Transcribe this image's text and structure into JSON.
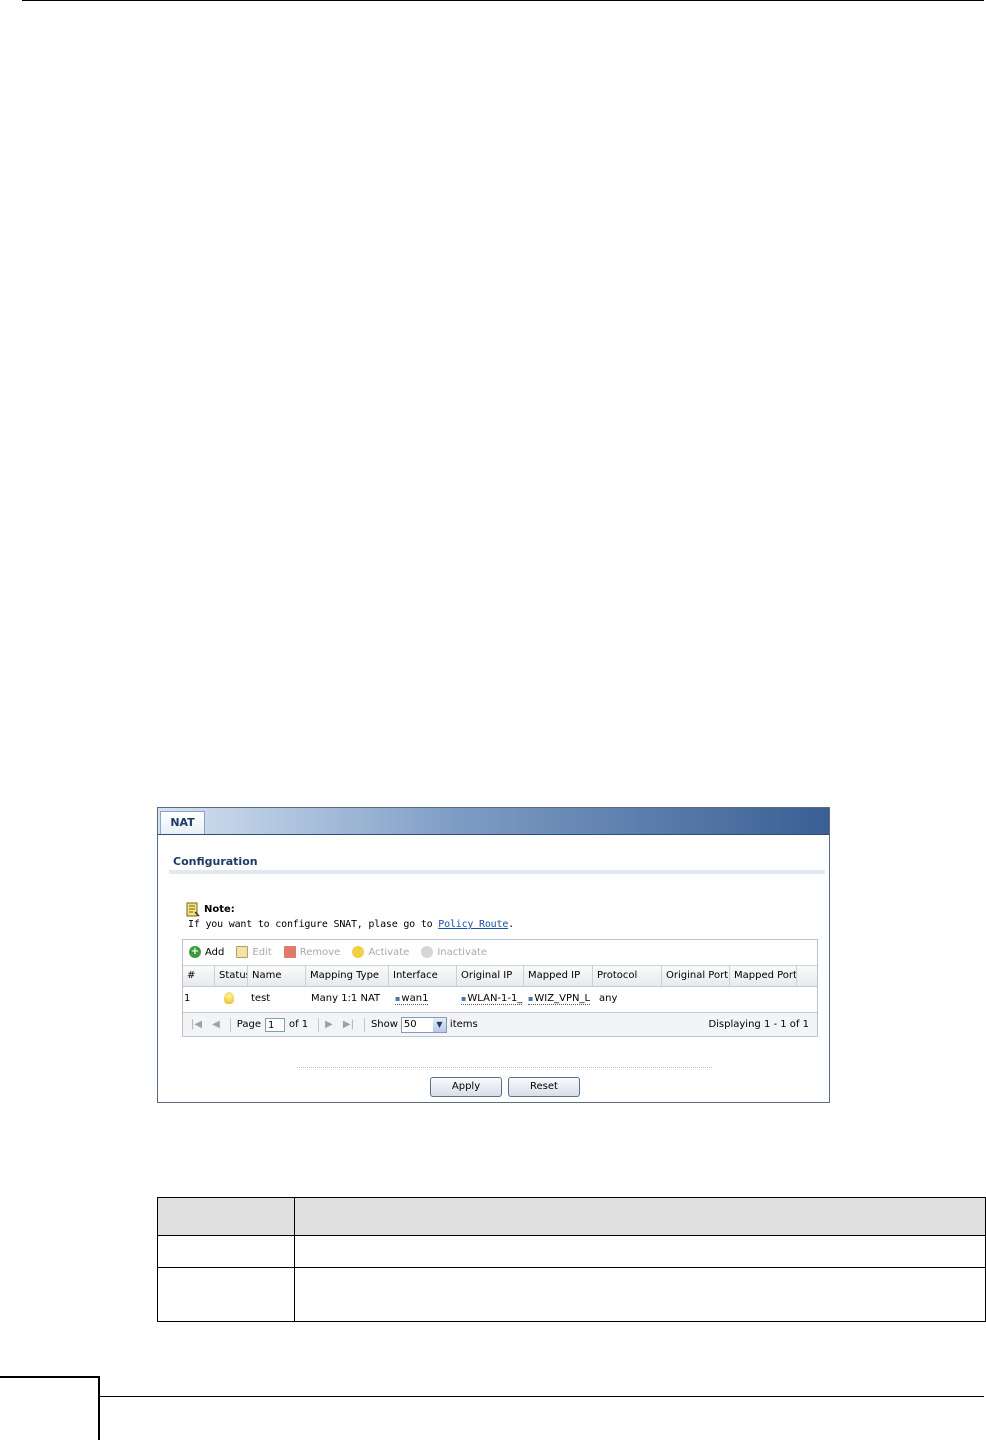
{
  "panel": {
    "tab_label": "NAT",
    "section_title": "Configuration",
    "note": {
      "title": "Note:",
      "text_before": "If you want to configure SNAT, plase go to ",
      "link": "Policy Route",
      "text_after": "."
    },
    "toolbar": {
      "add": "Add",
      "edit": "Edit",
      "remove": "Remove",
      "activate": "Activate",
      "inactivate": "Inactivate"
    },
    "columns": [
      "#",
      "Status",
      "Name",
      "Mapping Type",
      "Interface",
      "Original IP",
      "Mapped IP",
      "Protocol",
      "Original Port",
      "Mapped Port"
    ],
    "rows": [
      {
        "num": "1",
        "status": "bulb-icon",
        "name": "test",
        "mapping_type": "Many 1:1 NAT",
        "interface": "wan1",
        "original_ip": "WLAN-1-1_",
        "mapped_ip": "WIZ_VPN_L",
        "protocol": "any",
        "original_port": "",
        "mapped_port": ""
      }
    ],
    "pager": {
      "page_label": "Page",
      "page_value": "1",
      "of_label": "of 1",
      "show_label": "Show",
      "show_value": "50",
      "items_label": "items",
      "display_text": "Displaying 1 - 1 of 1"
    },
    "buttons": {
      "apply": "Apply",
      "reset": "Reset"
    }
  },
  "desc_table": {
    "rows": [
      [
        "",
        ""
      ],
      [
        "",
        ""
      ],
      [
        "",
        ""
      ]
    ]
  }
}
